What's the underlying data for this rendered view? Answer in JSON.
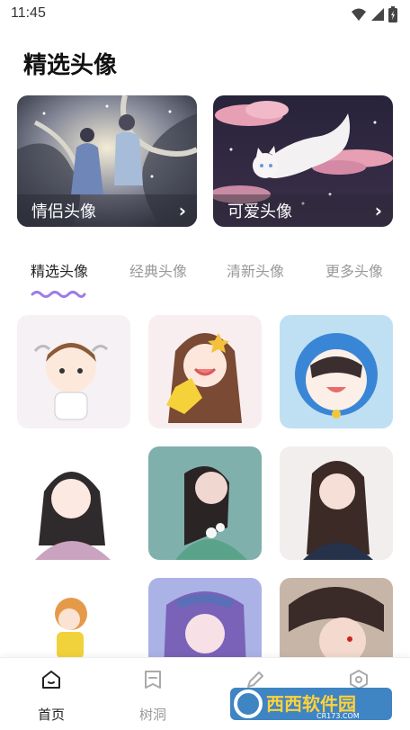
{
  "status_bar": {
    "time": "11:45",
    "icons": [
      "wifi-icon",
      "signal-icon",
      "battery-icon"
    ]
  },
  "page": {
    "title": "精选头像"
  },
  "feature_cards": [
    {
      "label": "情侣头像",
      "icon": "chevron-right-icon"
    },
    {
      "label": "可爱头像",
      "icon": "chevron-right-icon"
    }
  ],
  "tabs": [
    {
      "label": "精选头像",
      "active": true
    },
    {
      "label": "经典头像",
      "active": false
    },
    {
      "label": "清新头像",
      "active": false
    },
    {
      "label": "更多头像",
      "active": false
    }
  ],
  "avatars_count_visible": 9,
  "bottom_nav": [
    {
      "label": "首页",
      "icon": "home-icon",
      "active": true
    },
    {
      "label": "树洞",
      "icon": "note-icon",
      "active": false
    },
    {
      "label": "",
      "icon": "pencil-icon",
      "active": false
    },
    {
      "label": "",
      "icon": "settings-icon",
      "active": false
    }
  ],
  "watermark": {
    "text": "西西软件园",
    "sub": "CR173.COM"
  },
  "colors": {
    "accent": "#9b7be8",
    "text": "#222222",
    "muted": "#999999"
  }
}
